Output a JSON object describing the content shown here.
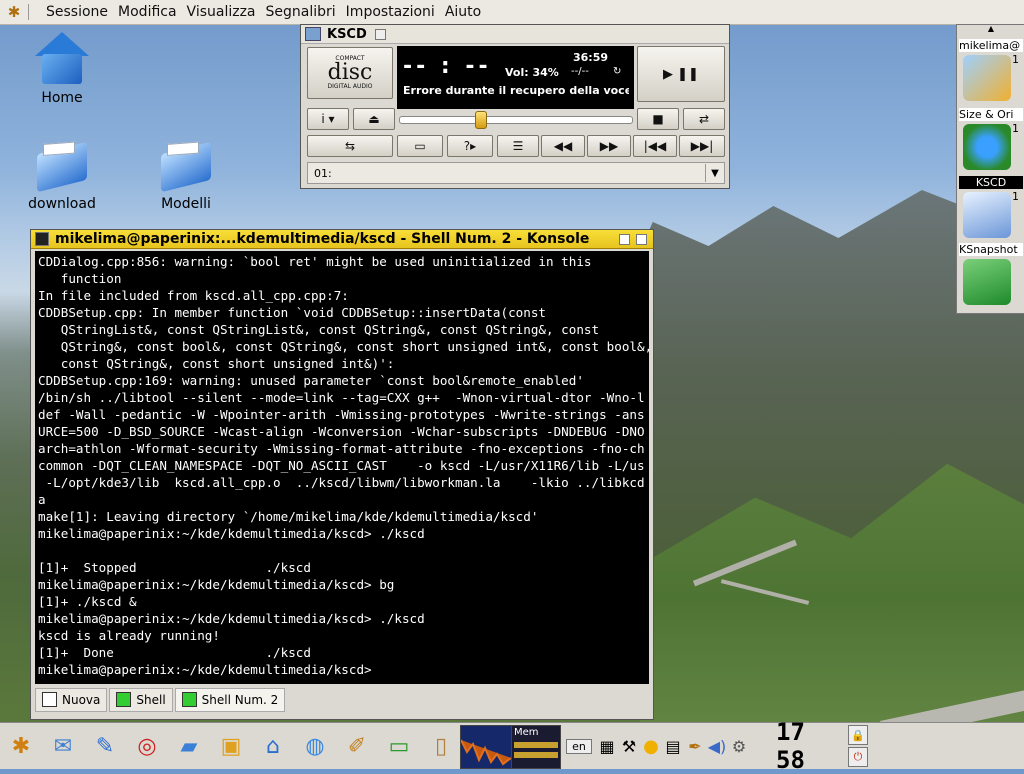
{
  "menubar": {
    "items": [
      "Sessione",
      "Modifica",
      "Visualizza",
      "Segnalibri",
      "Impostazioni",
      "Aiuto"
    ]
  },
  "desktop": {
    "icons": [
      {
        "label": "Home",
        "icon": "home-icon"
      },
      {
        "label": "download",
        "icon": "folder-icon"
      },
      {
        "label": "Modelli",
        "icon": "folder-icon"
      }
    ]
  },
  "kscd": {
    "title": "KSCD",
    "logo_top": "COMPACT",
    "logo_mid": "disc",
    "logo_bottom": "DIGITAL AUDIO",
    "time_display": "-- : --",
    "total_time": "36:59",
    "volume": "Vol: 34%",
    "track_display": "--/--",
    "loop_icon": "↻",
    "error_text": "Errore durante il recupero della voce freedb",
    "volume_fraction": 0.34,
    "buttons": {
      "play_pause": "▶ ❚❚",
      "info": "i ▾",
      "eject": "⏏",
      "stop": "■",
      "loop": "⇄",
      "shuffle": "⇆",
      "options": "▭",
      "help": "?▸",
      "tracklist": "☰",
      "rewind": "◀◀",
      "forward": "▶▶",
      "prev": "|◀◀",
      "next": "▶▶|"
    },
    "track_select": "01:"
  },
  "dock": {
    "items": [
      {
        "label": "mikelima@",
        "count": "1"
      },
      {
        "label": "Size & Ori",
        "count": "1"
      },
      {
        "label": "KSCD",
        "count": "1"
      },
      {
        "label": "KSnapshot",
        "count": ""
      }
    ]
  },
  "konsole": {
    "title": "mikelima@paperinix:...kdemultimedia/kscd - Shell Num. 2 - Konsole",
    "lines": [
      "CDDialog.cpp:856: warning: `bool ret' might be used uninitialized in this",
      "   function",
      "In file included from kscd.all_cpp.cpp:7:",
      "CDDBSetup.cpp: In member function `void CDDBSetup::insertData(const",
      "   QStringList&, const QStringList&, const QString&, const QString&, const",
      "   QString&, const bool&, const QString&, const short unsigned int&, const bool&,",
      "   const QString&, const short unsigned int&)':",
      "CDDBSetup.cpp:169: warning: unused parameter `const bool&remote_enabled'",
      "/bin/sh ../libtool --silent --mode=link --tag=CXX g++  -Wnon-virtual-dtor -Wno-l",
      "def -Wall -pedantic -W -Wpointer-arith -Wmissing-prototypes -Wwrite-strings -ans",
      "URCE=500 -D_BSD_SOURCE -Wcast-align -Wconversion -Wchar-subscripts -DNDEBUG -DNO",
      "arch=athlon -Wformat-security -Wmissing-format-attribute -fno-exceptions -fno-ch",
      "common -DQT_CLEAN_NAMESPACE -DQT_NO_ASCII_CAST    -o kscd -L/usr/X11R6/lib -L/us",
      " -L/opt/kde3/lib  kscd.all_cpp.o  ../kscd/libwm/libworkman.la    -lkio ../libkcd",
      "a",
      "make[1]: Leaving directory `/home/mikelima/kde/kdemultimedia/kscd'",
      "mikelima@paperinix:~/kde/kdemultimedia/kscd> ./kscd",
      "",
      "[1]+  Stopped                 ./kscd",
      "mikelima@paperinix:~/kde/kdemultimedia/kscd> bg",
      "[1]+ ./kscd &",
      "mikelima@paperinix:~/kde/kdemultimedia/kscd> ./kscd",
      "kscd is already running!",
      "[1]+  Done                    ./kscd",
      "mikelima@paperinix:~/kde/kdemultimedia/kscd> "
    ],
    "tabs": [
      {
        "label": "Nuova",
        "icon": "new-tab-icon"
      },
      {
        "label": "Shell",
        "icon": "terminal-icon"
      },
      {
        "label": "Shell Num. 2",
        "icon": "terminal-icon"
      }
    ]
  },
  "taskbar": {
    "launchers": [
      "kmenu-icon",
      "kontact-icon",
      "kmail-icon",
      "help-lifebuoy-icon",
      "konqueror-folder-icon",
      "desktop-preview-icon",
      "home-icon",
      "konqueror-globe-icon",
      "kate-icon",
      "monitor-icon",
      "kwallet-icon"
    ],
    "mem_label": "Mem",
    "tray_icons": [
      "keyboard-layout-icon",
      "calendar-icon",
      "tools-icon",
      "sun-icon",
      "lock-icon",
      "paint-icon",
      "speaker-icon",
      "settings-icon"
    ],
    "clock": "17 58"
  }
}
